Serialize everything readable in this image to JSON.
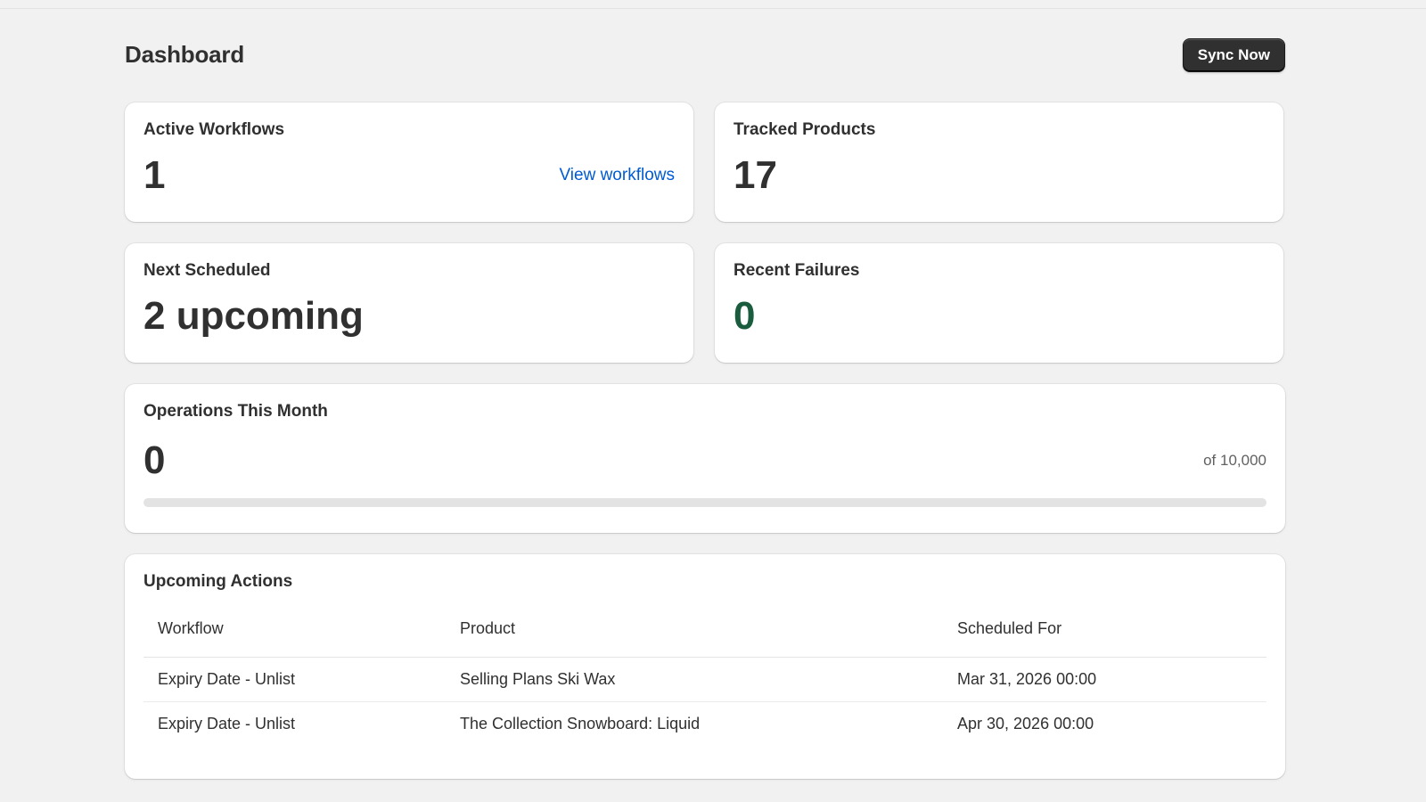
{
  "header": {
    "title": "Dashboard",
    "sync_label": "Sync Now"
  },
  "stats": {
    "active_workflows": {
      "title": "Active Workflows",
      "value": "1",
      "link": "View workflows"
    },
    "tracked_products": {
      "title": "Tracked Products",
      "value": "17"
    },
    "next_scheduled": {
      "title": "Next Scheduled",
      "value": "2 upcoming"
    },
    "recent_failures": {
      "title": "Recent Failures",
      "value": "0",
      "value_color": "#1a5c3e"
    }
  },
  "operations": {
    "title": "Operations This Month",
    "value": "0",
    "limit_text": "of 10,000",
    "progress_fraction": 0
  },
  "upcoming": {
    "title": "Upcoming Actions",
    "columns": [
      "Workflow",
      "Product",
      "Scheduled For"
    ],
    "rows": [
      [
        "Expiry Date - Unlist",
        "Selling Plans Ski Wax",
        "Mar 31, 2026 00:00"
      ],
      [
        "Expiry Date - Unlist",
        "The Collection Snowboard: Liquid",
        "Apr 30, 2026 00:00"
      ]
    ]
  },
  "colors": {
    "background": "#f1f1f1",
    "link": "#005bd3",
    "button": "#303030"
  }
}
